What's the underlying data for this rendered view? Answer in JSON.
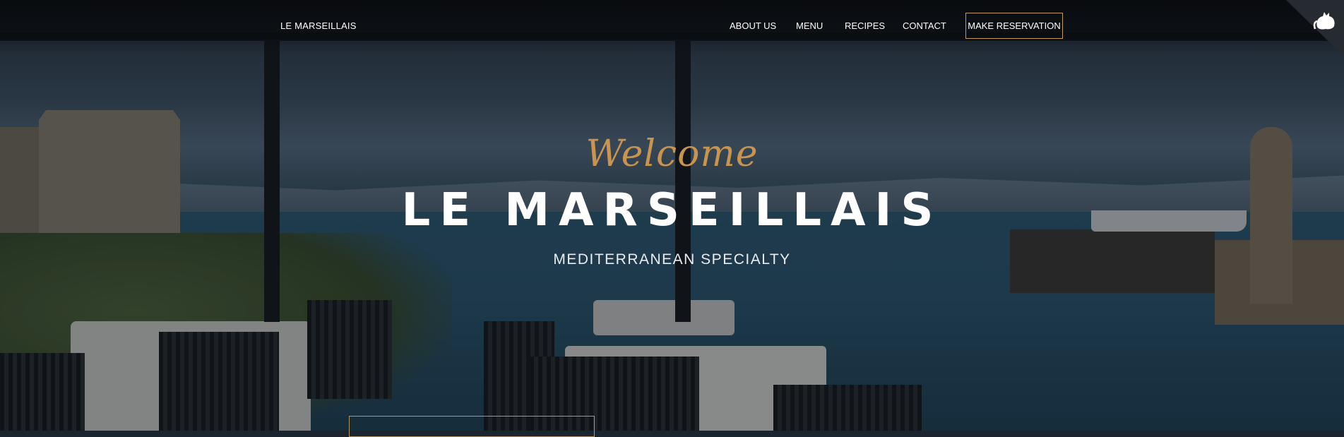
{
  "nav": {
    "brand": "LE MARSEILLAIS",
    "items": [
      {
        "label": "ABOUT US"
      },
      {
        "label": "MENU"
      },
      {
        "label": "RECIPES"
      },
      {
        "label": "CONTACT"
      }
    ],
    "reservation_label": "MAKE RESERVATION",
    "corner_icon": "cat-icon"
  },
  "hero": {
    "welcome": "Welcome",
    "title": "LE MARSEILLAIS",
    "subtitle": "MEDITERRANEAN SPECIALTY",
    "background": "rooftop-terrace-harbor-view"
  },
  "colors": {
    "accent": "#c9944f",
    "text": "#ffffff",
    "button_border": "#c49a5a"
  }
}
